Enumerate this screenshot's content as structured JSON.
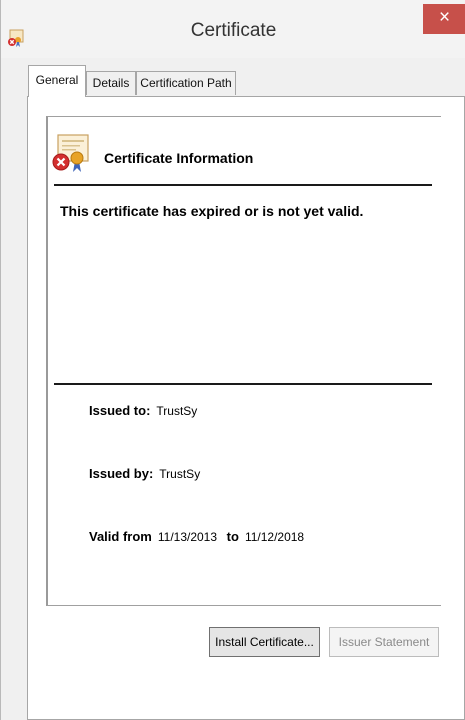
{
  "window": {
    "title": "Certificate",
    "close_label": "×"
  },
  "tabs": [
    {
      "label": "General",
      "active": true
    },
    {
      "label": "Details",
      "active": false
    },
    {
      "label": "Certification Path",
      "active": false
    }
  ],
  "info": {
    "heading": "Certificate Information",
    "status_message": "This certificate has expired or is not yet valid.",
    "issued_to_label": "Issued to:",
    "issued_to": "TrustSy",
    "issued_by_label": "Issued by:",
    "issued_by": "TrustSy",
    "valid_from_label": "Valid from",
    "valid_from": "11/13/2013",
    "to_label": "to",
    "valid_to": "11/12/2018"
  },
  "buttons": {
    "install": "Install Certificate...",
    "issuer_statement": "Issuer Statement"
  },
  "colors": {
    "close_button": "#c7504a",
    "window_bg": "#f0f0f0",
    "error_badge": "#d32f2f"
  },
  "icons": {
    "title": "certificate-error-icon",
    "info": "certificate-error-icon",
    "close": "close-icon"
  }
}
